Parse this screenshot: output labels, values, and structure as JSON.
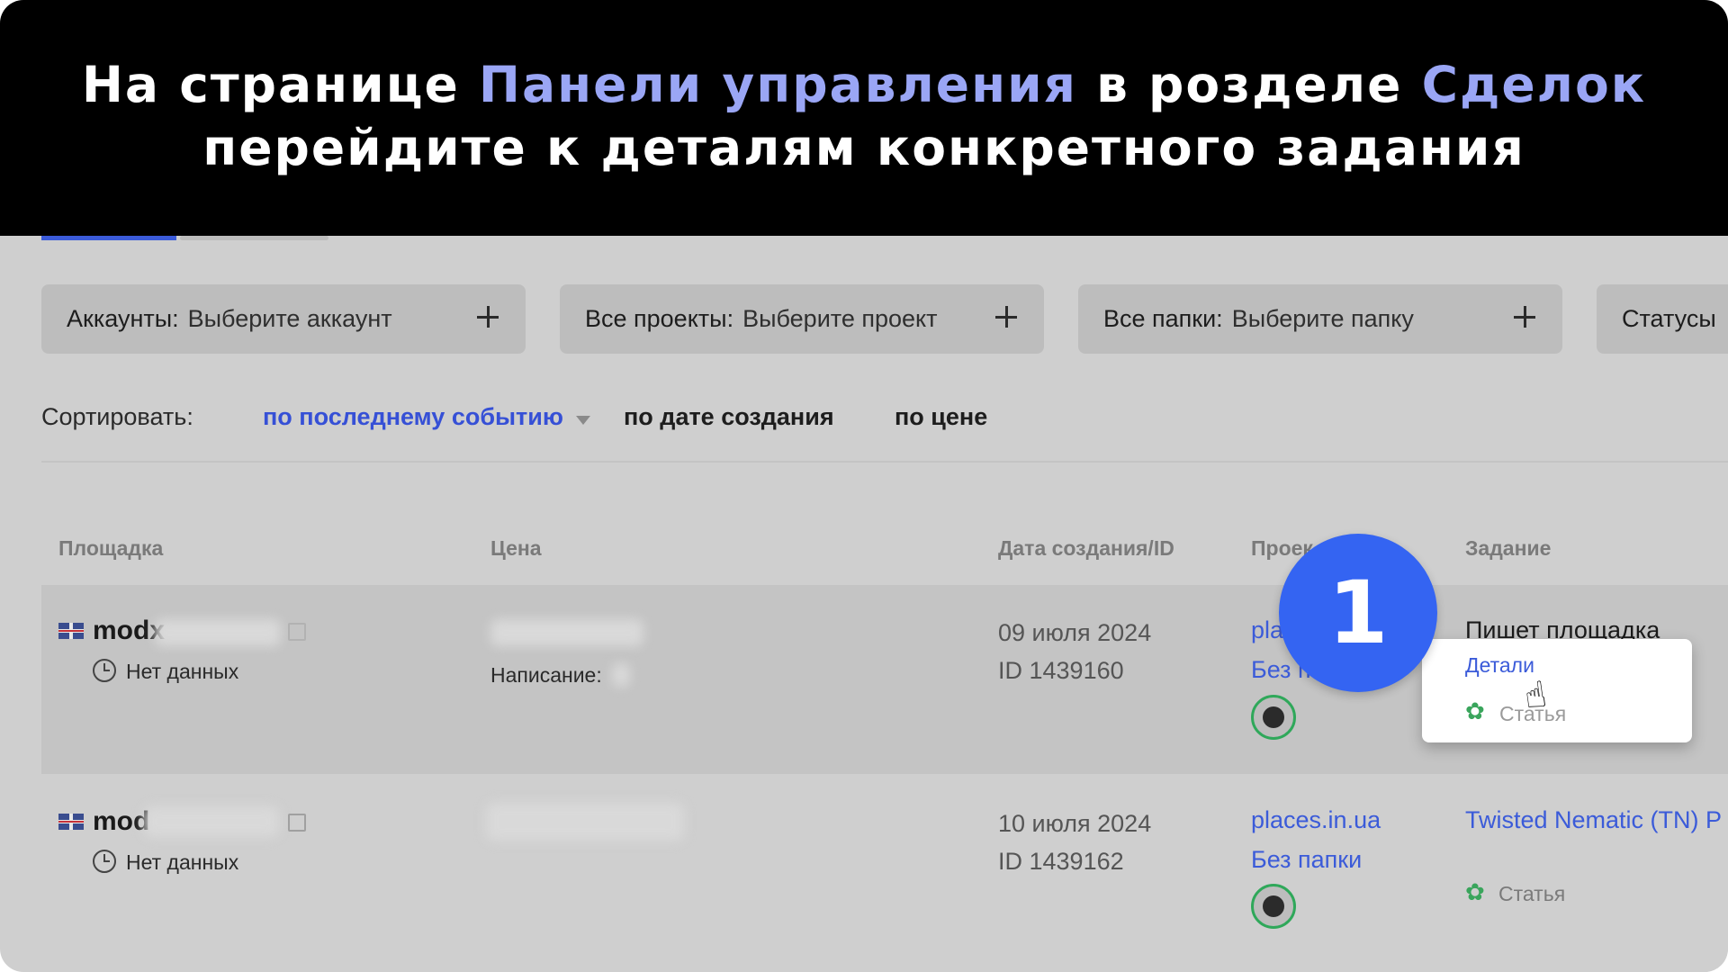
{
  "banner": {
    "line1_part1": "На странице ",
    "line1_highlight1": "Панели управления",
    "line1_part2": " в розделе ",
    "line1_highlight2": "Сделок",
    "line2": "перейдите к деталям конкретного задания",
    "highlight_color": "#9aa6f5"
  },
  "filters": [
    {
      "label": "Аккаунты:",
      "value": "Выберите аккаунт"
    },
    {
      "label": "Все проекты:",
      "value": "Выберите проект"
    },
    {
      "label": "Все папки:",
      "value": "Выберите папку"
    },
    {
      "label": "Статусы",
      "value": ""
    }
  ],
  "sort": {
    "label": "Сортировать:",
    "active": "по последнему событию",
    "options": [
      "по дате создания",
      "по цене"
    ]
  },
  "table": {
    "headers": [
      "Площадка",
      "Цена",
      "Дата создания/ID",
      "Проек",
      "Задание"
    ],
    "rows": [
      {
        "site": "modx",
        "no_data": "Нет данных",
        "price_sub": "Написание:",
        "date": "09 июля 2024",
        "id": "ID 1439160",
        "project": "pla",
        "folder": "Без п",
        "task_title": "Пишет площадка"
      },
      {
        "site": "mod",
        "no_data": "Нет данных",
        "date": "10 июля 2024",
        "id": "ID 1439162",
        "project": "places.in.ua",
        "folder": "Без папки",
        "task_title": "Twisted Nematic (TN) P",
        "task_type": "Статья"
      }
    ]
  },
  "popup": {
    "details": "Детали",
    "type": "Статья"
  },
  "step_badge": "1",
  "icons": {
    "leaf": "leaf-icon",
    "clock": "clock-icon",
    "external": "external-link-icon",
    "cursor": "hand-cursor-icon",
    "flag": "uk-flag-icon"
  },
  "colors": {
    "accent": "#3b5bd9",
    "badge": "#3464f2",
    "green": "#3aa55c"
  }
}
